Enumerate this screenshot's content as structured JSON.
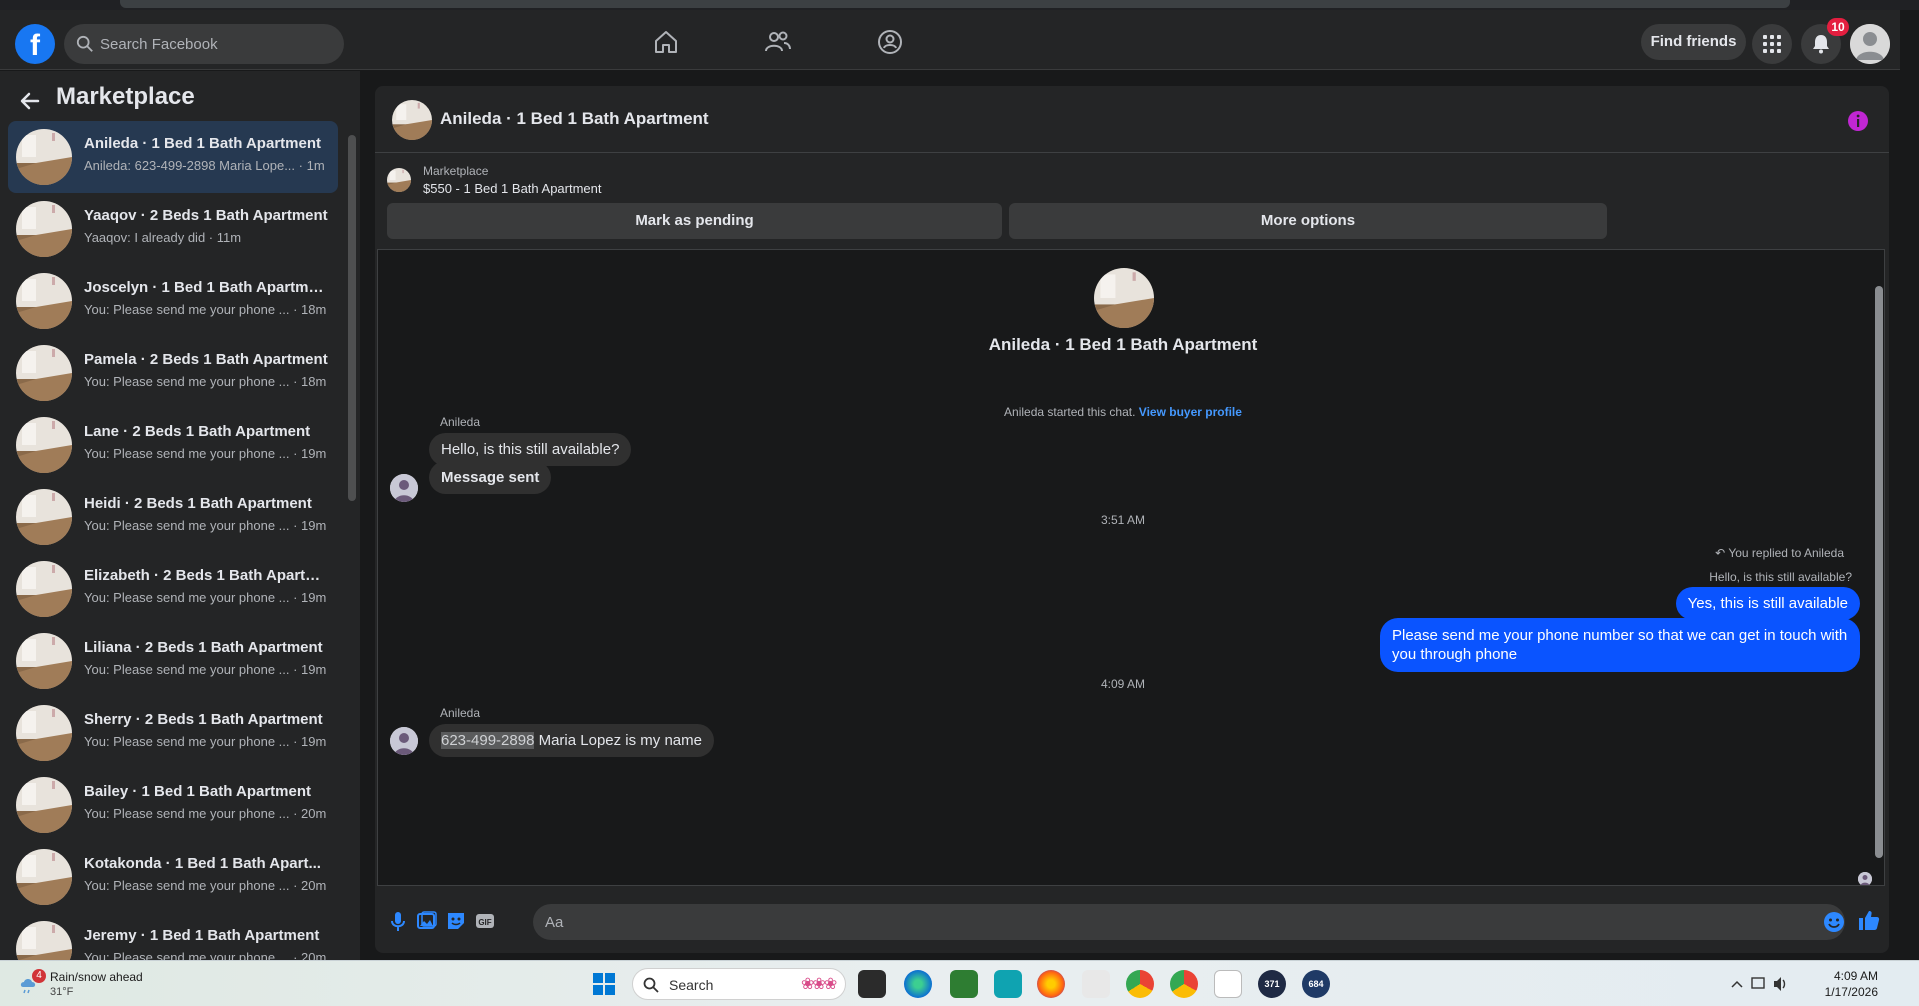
{
  "search": {
    "placeholder": "Search Facebook"
  },
  "header": {
    "find_friends": "Find friends",
    "notification_count": "10"
  },
  "sidebar": {
    "title": "Marketplace",
    "conversations": [
      {
        "name": "Anileda · 1 Bed 1 Bath Apartment",
        "preview": "Anileda: 623-499-2898 Maria Lope... · 1m",
        "active": true
      },
      {
        "name": "Yaaqov · 2 Beds 1 Bath Apartment",
        "preview": "Yaaqov: I already did · 11m"
      },
      {
        "name": "Joscelyn · 1 Bed 1 Bath Apartment",
        "preview": "You: Please send me your phone ... · 18m"
      },
      {
        "name": "Pamela · 2 Beds 1 Bath Apartment",
        "preview": "You: Please send me your phone ... · 18m"
      },
      {
        "name": "Lane · 2 Beds 1 Bath Apartment",
        "preview": "You: Please send me your phone ... · 19m"
      },
      {
        "name": "Heidi · 2 Beds 1 Bath Apartment",
        "preview": "You: Please send me your phone ... · 19m"
      },
      {
        "name": "Elizabeth · 2 Beds 1 Bath Apartm...",
        "preview": "You: Please send me your phone ... · 19m"
      },
      {
        "name": "Liliana · 2 Beds 1 Bath Apartment",
        "preview": "You: Please send me your phone ... · 19m"
      },
      {
        "name": "Sherry · 2 Beds 1 Bath Apartment",
        "preview": "You: Please send me your phone ... · 19m"
      },
      {
        "name": "Bailey · 1 Bed 1 Bath Apartment",
        "preview": "You: Please send me your phone ... · 20m"
      },
      {
        "name": "Kotakonda · 1 Bed 1 Bath Apart...",
        "preview": "You: Please send me your phone ... · 20m"
      },
      {
        "name": "Jeremy · 1 Bed 1 Bath Apartment",
        "preview": "You: Please send me your phone ... · 20m"
      }
    ]
  },
  "chat": {
    "title": "Anileda · 1 Bed 1 Bath Apartment",
    "listing_source": "Marketplace",
    "listing_price": "$550 - 1 Bed 1 Bath Apartment",
    "mark_pending": "Mark as pending",
    "more_options": "More options",
    "intro_title": "Anileda · 1 Bed 1 Bath Apartment",
    "started_text": "Anileda started this chat.",
    "view_buyer_profile": "View buyer profile",
    "sender_name": "Anileda",
    "msg1": "Hello, is this still available?",
    "msg2": "Message sent",
    "time1": "3:51 AM",
    "replied_note": "You replied to Anileda",
    "quoted_text": "Hello, is this still available?",
    "reply1": "Yes, this is still available",
    "reply2": "Please send me your phone  number so that we can get in touch with you through phone",
    "time2": "4:09 AM",
    "phone": "623-499-2898",
    "msg3_rest": " Maria Lopez is my name",
    "composer_placeholder": "Aa"
  },
  "taskbar": {
    "weather_title": "Rain/snow ahead",
    "weather_temp": "31°F",
    "weather_badge": "4",
    "search_label": "Search",
    "time": "4:09 AM",
    "date": "1/17/2026",
    "app_badges": [
      "371",
      "684"
    ]
  },
  "colors": {
    "accent": "#0a54ff",
    "link": "#4599ff",
    "active_row": "#263951",
    "badge": "#e41e3f",
    "info": "#c026d3"
  }
}
